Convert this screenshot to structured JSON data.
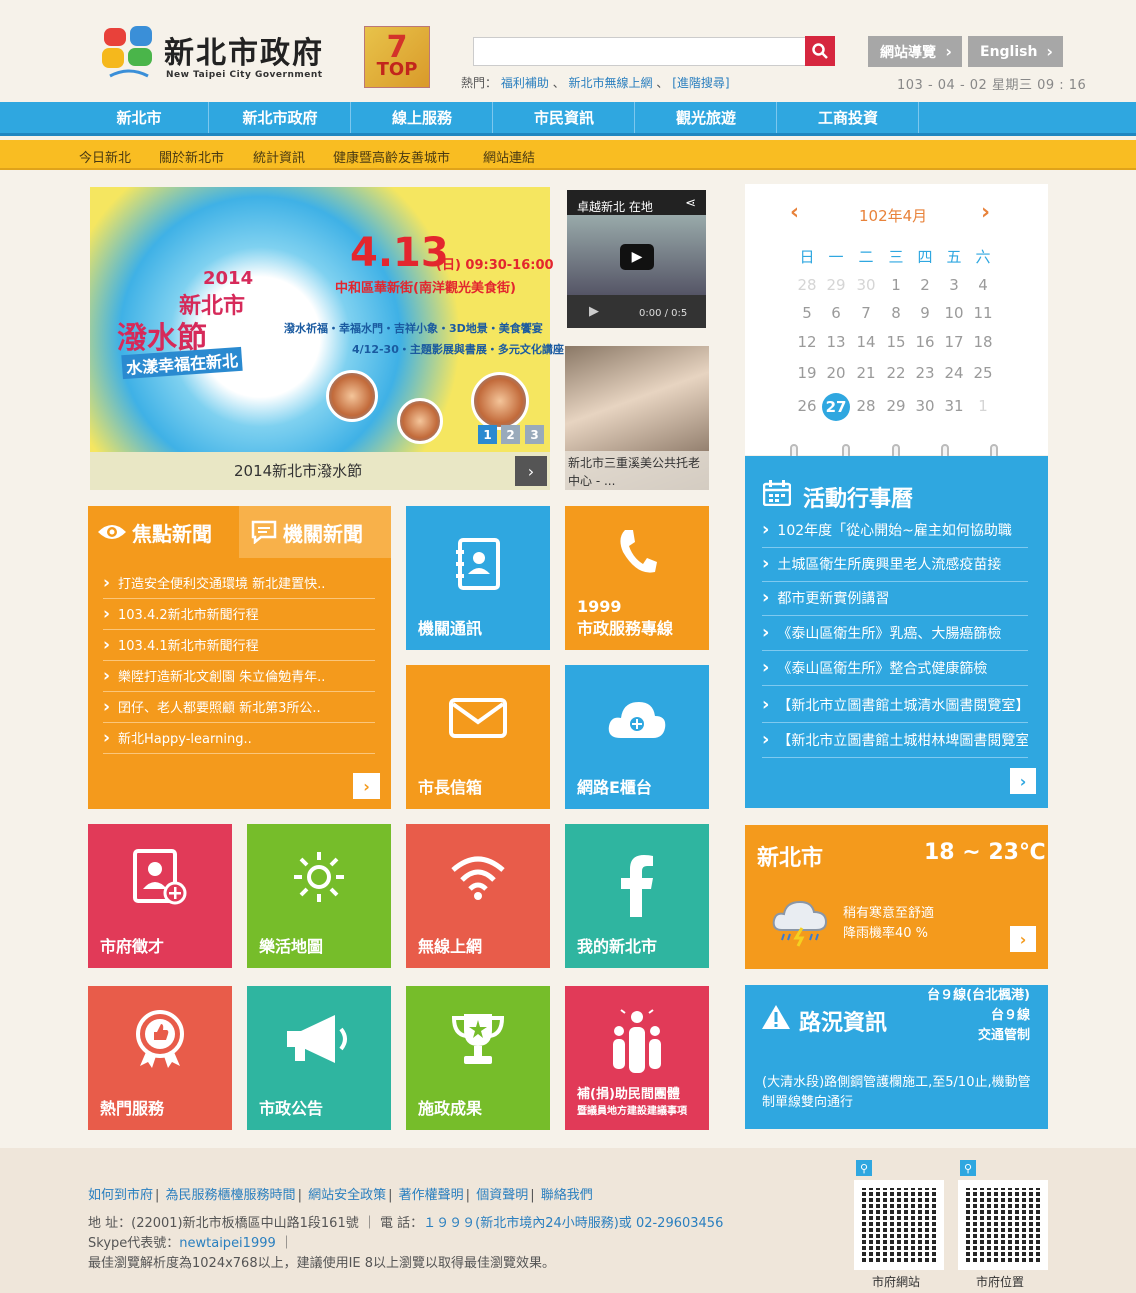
{
  "header": {
    "logo_cn": "新北市政府",
    "logo_en": "New Taipei City Government",
    "top_badge": "TOP",
    "search_placeholder": "",
    "hot_label": "熱門：",
    "hot_links": [
      "福利補助",
      "新北市無線上網",
      "[進階搜尋]"
    ],
    "sitemap_label": "網站導覽",
    "english_label": "English",
    "datetime": "103 - 04 - 02 星期三 09 : 16"
  },
  "nav": {
    "items": [
      "新北市",
      "新北市政府",
      "線上服務",
      "市民資訊",
      "觀光旅遊",
      "工商投資"
    ]
  },
  "subnav": {
    "items": [
      "今日新北",
      "關於新北市",
      "統計資訊",
      "健康暨高齡友善城市",
      "網站連結"
    ]
  },
  "slider": {
    "date": "4.13",
    "time": "(日) 09:30-16:00",
    "location": "中和區華新街(南洋觀光美食街)",
    "line1": "潑水祈福・幸福水門・吉祥小象・3D地景・美食饗宴",
    "line2": "4/12-30・主題影展與書展・多元文化講座",
    "year": "2014",
    "name1": "新北市",
    "name2": "潑水節",
    "tagline": "水漾幸福在新北",
    "dots": [
      "1",
      "2",
      "3"
    ],
    "caption": "2014新北市潑水節"
  },
  "video": {
    "title": "卓越新北 在地",
    "time": "0:00 / 0:5"
  },
  "news_photo": {
    "caption": "新北市三重溪美公共托老中心 - ..."
  },
  "calendar": {
    "title": "102年4月",
    "weekdays": [
      "日",
      "一",
      "二",
      "三",
      "四",
      "五",
      "六"
    ],
    "weeks": [
      [
        "28",
        "29",
        "30",
        "1",
        "2",
        "3",
        "4"
      ],
      [
        "5",
        "6",
        "7",
        "8",
        "9",
        "10",
        "11"
      ],
      [
        "12",
        "13",
        "14",
        "15",
        "16",
        "17",
        "18"
      ],
      [
        "19",
        "20",
        "21",
        "22",
        "23",
        "24",
        "25"
      ],
      [
        "26",
        "27",
        "28",
        "29",
        "30",
        "31",
        "1"
      ]
    ],
    "today": "27"
  },
  "events": {
    "title": "活動行事曆",
    "items": [
      "102年度「從心開始~雇主如何協助職",
      "土城區衛生所廣興里老人流感疫苗接",
      "都市更新實例講習",
      "《泰山區衛生所》乳癌、大腸癌篩檢",
      "《泰山區衛生所》整合式健康篩檢",
      "【新北市立圖書館土城清水圖書閱覽室】",
      "【新北市立圖書館土城柑林埤圖書閱覽室"
    ]
  },
  "news": {
    "tab_focus": "焦點新聞",
    "tab_agency": "機關新聞",
    "items": [
      "打造安全便利交通環境 新北建置快..",
      "103.4.2新北市新聞行程",
      "103.4.1新北市新聞行程",
      "樂陞打造新北文創園 朱立倫勉青年..",
      "囝仔、老人都要照顧 新北第3所公..",
      "新北Happy-learning.."
    ]
  },
  "tiles": {
    "directory": "機關通訊",
    "hotline_num": "1999",
    "hotline": "市政服務專線",
    "mayor_mail": "市長信箱",
    "e_counter": "網路E櫃台",
    "recruit": "市府徵才",
    "fun_map": "樂活地圖",
    "wifi": "無線上網",
    "my_city": "我的新北市",
    "hot_service": "熱門服務",
    "announce": "市政公告",
    "results": "施政成果",
    "subsidy1": "補(捐)助民間團體",
    "subsidy2": "暨議員地方建設建議事項"
  },
  "weather": {
    "city": "新北市",
    "temp": "18 ~ 23℃",
    "desc1": "稍有寒意至舒適",
    "desc2": "降雨機率40 %"
  },
  "traffic": {
    "title": "路況資訊",
    "road1": "台９線(台北楓港)",
    "road2": "台９線",
    "road3": "交通管制",
    "text": "(大清水段)路側鋼管護欄施工,至5/10止,機動管制單線雙向通行"
  },
  "footer": {
    "links": [
      "如何到市府",
      "為民服務櫃檯服務時間",
      "網站安全政策",
      "著作權聲明",
      "個資聲明",
      "聯絡我們"
    ],
    "addr_label": "地 址：(22001)新北市板橋區中山路1段161號 ｜ 電 話：",
    "phone": "１９９９(新北市境內24小時服務)或 02-29603456",
    "skype_label": "Skype代表號：",
    "skype": "newtaipei1999",
    "skype_sep": "｜",
    "resolution": "最佳瀏覽解析度為1024x768以上，建議使用IE 8以上瀏覽以取得最佳瀏覽效果。",
    "qr1_label": "市府網站",
    "qr2_label": "市府位置"
  },
  "colors": {
    "blue": "#2fa7e0",
    "orange": "#f49a1c",
    "yellow": "#f9bd22",
    "red": "#e13a58",
    "green": "#76bd2a",
    "coral": "#e85c4a",
    "teal": "#2fb5a0"
  }
}
